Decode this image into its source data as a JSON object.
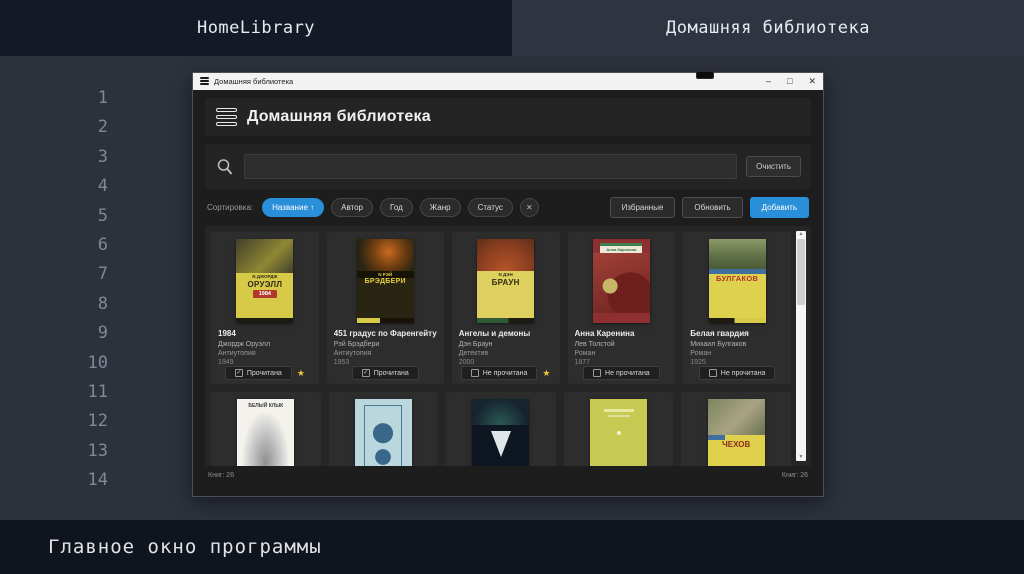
{
  "colors": {
    "accent_blue": "#2a8fd9",
    "favorite_star": "#e7c93f",
    "slide_bg": "#2c313c",
    "header_left_bg": "#141926",
    "header_right_bg": "#2f3540",
    "caption_bg": "#10141d",
    "titlebar_bg": "#f2f2f2"
  },
  "slide": {
    "header_left": "HomeLibrary",
    "header_right": "Домашняя библиотека",
    "line_numbers": [
      "1",
      "2",
      "3",
      "4",
      "5",
      "6",
      "7",
      "8",
      "9",
      "10",
      "11",
      "12",
      "13",
      "14"
    ],
    "caption": "Главное окно программы"
  },
  "window": {
    "titlebar": {
      "title": "Домашняя библиотека",
      "minimize": "–",
      "maximize": "□",
      "close": "✕"
    },
    "header": {
      "title": "Домашняя библиотека"
    },
    "search": {
      "value": "",
      "placeholder": "",
      "clear_label": "Очистить"
    },
    "toolbar": {
      "sort_label": "Сортировка:",
      "sort_active": "Название ↑",
      "sort_author": "Автор",
      "sort_year": "Год",
      "sort_genre": "Жанр",
      "sort_status": "Статус",
      "sort_clear": "✕",
      "favorites_label": "Избранные",
      "refresh_label": "Обновить",
      "add_label": "Добавить"
    },
    "books": [
      {
        "title": "1984",
        "author": "Джордж Оруэлл",
        "genre": "Антиутопия",
        "year": "1949",
        "status": "Прочитана",
        "favorite": true,
        "cover": {
          "bg": "#d8ca49",
          "band": "N ДЖОРДЖ",
          "big": "ОРУЭЛЛ",
          "badge": "1984"
        }
      },
      {
        "title": "451 градус по Фаренгейту",
        "author": "Рэй Брэдбери",
        "genre": "Антиутопия",
        "year": "1953",
        "status": "Прочитана",
        "favorite": false,
        "cover": {
          "bg": "#2a2413",
          "band": "N РЭЙ",
          "big": "БРЭДБЕРИ"
        }
      },
      {
        "title": "Ангелы и демоны",
        "author": "Дэн Браун",
        "genre": "Детектив",
        "year": "2000",
        "status": "Не прочитана",
        "favorite": true,
        "cover": {
          "bg": "#ddd05e",
          "band": "N ДЭН",
          "big": "БРАУН"
        }
      },
      {
        "title": "Анна Каренина",
        "author": "Лев Толстой",
        "genre": "Роман",
        "year": "1877",
        "status": "Не прочитана",
        "favorite": false,
        "cover": {
          "bg": "#8e3030",
          "label": "Анна Каренина"
        }
      },
      {
        "title": "Белая гвардия",
        "author": "Михаил Булгаков",
        "genre": "Роман",
        "year": "1925",
        "status": "Не прочитана",
        "favorite": false,
        "cover": {
          "bg": "#ddd14e",
          "big": "БУЛГАКОВ"
        }
      }
    ],
    "shelf_row2": [
      {
        "cover_text": "БЕЛЫЙ КЛЫК",
        "bg": "#f4f2ec"
      },
      {
        "cover_text": "",
        "bg": "#b9d7dd"
      },
      {
        "cover_text": "",
        "bg": "#0e1622"
      },
      {
        "cover_text": "",
        "bg": "#c6ca52"
      },
      {
        "cover_text": "ЧЕХОВ",
        "bg": "#e0d14c"
      }
    ],
    "statusbar": {
      "left": "Книг: 26",
      "right": "Книг: 26"
    }
  }
}
